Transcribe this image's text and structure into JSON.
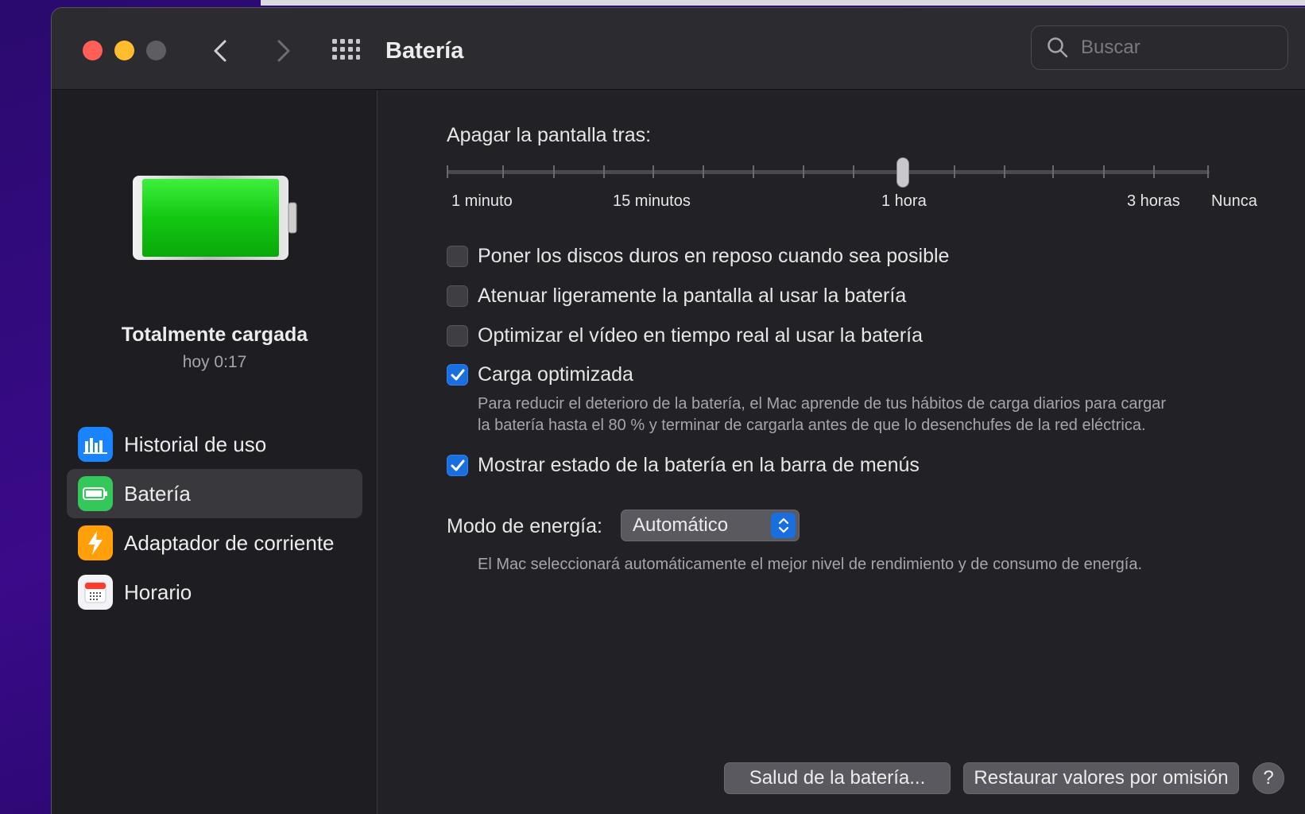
{
  "window": {
    "title": "Batería"
  },
  "search": {
    "placeholder": "Buscar"
  },
  "sidebar": {
    "status_title": "Totalmente cargada",
    "status_time": "hoy 0:17",
    "items": [
      {
        "label": "Historial de uso",
        "icon": "bar-chart-icon",
        "color": "#1a84ff"
      },
      {
        "label": "Batería",
        "icon": "battery-icon",
        "color": "#34c759",
        "selected": true
      },
      {
        "label": "Adaptador de corriente",
        "icon": "lightning-bolt-icon",
        "color": "#ff9f0a"
      },
      {
        "label": "Horario",
        "icon": "calendar-icon",
        "color": "#f2f2f7"
      }
    ]
  },
  "main": {
    "display_sleep": {
      "label": "Apagar la pantalla tras:",
      "value": "1 hora",
      "tick_labels": [
        "1 minuto",
        "15 minutos",
        "1 hora",
        "3 horas",
        "Nunca"
      ]
    },
    "options": [
      {
        "label": "Poner los discos duros en reposo cuando sea posible",
        "checked": false
      },
      {
        "label": "Atenuar ligeramente la pantalla al usar la batería",
        "checked": false
      },
      {
        "label": "Optimizar el vídeo en tiempo real al usar la batería",
        "checked": false
      },
      {
        "label": "Carga optimizada",
        "checked": true
      },
      {
        "label": "Mostrar estado de la batería en la barra de menús",
        "checked": true
      }
    ],
    "optimized_desc_line1": "Para reducir el deterioro de la batería, el Mac aprende de tus hábitos de carga diarios para cargar",
    "optimized_desc_line2": "la batería hasta el 80 % y terminar de cargarla antes de que lo desenchufes de la red eléctrica.",
    "energy_mode": {
      "label": "Modo de energía:",
      "value": "Automático",
      "description": "El Mac seleccionará automáticamente el mejor nivel de rendimiento y de consumo de energía."
    },
    "buttons": {
      "battery_health": "Salud de la batería...",
      "restore_defaults": "Restaurar valores por omisión",
      "help": "?"
    }
  },
  "colors": {
    "accent": "#1a6fe0",
    "battery_green": "#1fd21f"
  }
}
